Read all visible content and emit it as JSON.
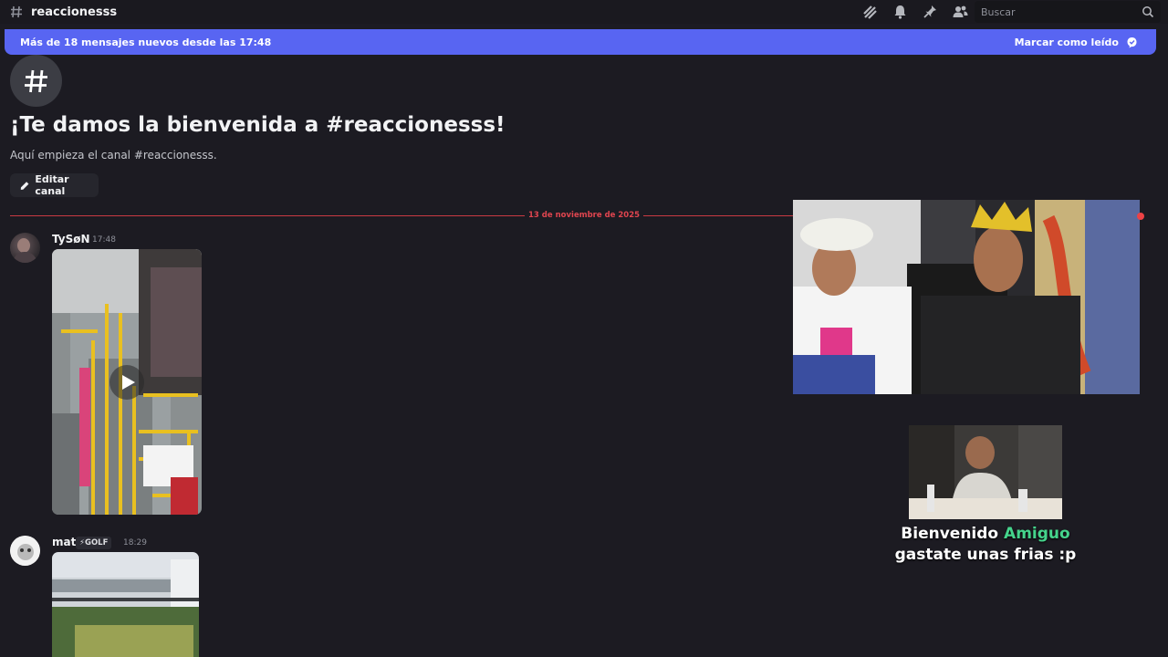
{
  "header": {
    "channel_name": "reaccionesss",
    "icons": [
      "threads-icon",
      "bell-icon",
      "pin-icon",
      "members-icon"
    ],
    "search_placeholder": "Buscar"
  },
  "banner": {
    "text": "Más de 18 mensajes nuevos desde las 17:48",
    "mark_read": "Marcar como leído"
  },
  "welcome": {
    "title": "¡Te damos la bienvenida a #reaccionesss!",
    "subtitle": "Aquí empieza el canal #reaccionesss.",
    "edit_button": "Editar canal"
  },
  "divider": {
    "date": "13 de noviembre de 2025"
  },
  "messages": [
    {
      "author": "TySøN",
      "time": "17:48",
      "attachment": "video"
    },
    {
      "author": "mat",
      "badge": "⚡GOLF",
      "time": "18:29",
      "attachment": "video"
    }
  ],
  "overlay": {
    "greeting_word": "Bienvenido",
    "greeting_name": "Amiguo",
    "line2": "gastate unas frias :p"
  },
  "colors": {
    "background": "#1c1b22",
    "banner": "#5865f2",
    "divider": "#c93a43",
    "highlight_name": "#45d48c"
  }
}
